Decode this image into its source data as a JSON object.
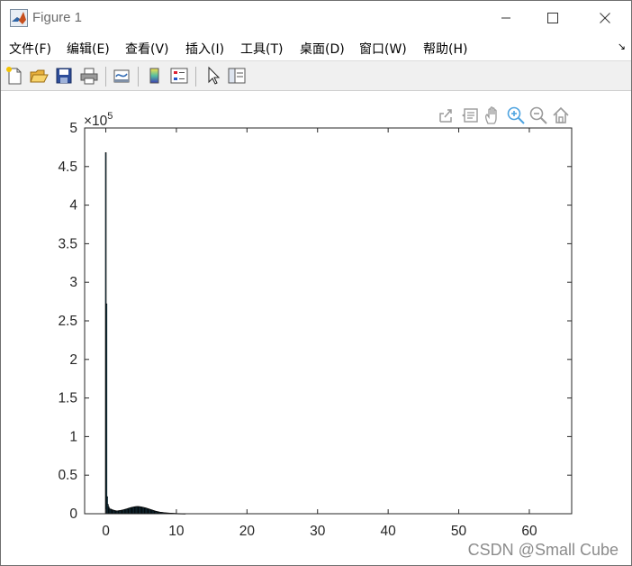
{
  "window": {
    "title": "Figure 1",
    "controls": [
      "minimize",
      "maximize",
      "close"
    ]
  },
  "menu": {
    "items": [
      "文件(F)",
      "编辑(E)",
      "查看(V)",
      "插入(I)",
      "工具(T)",
      "桌面(D)",
      "窗口(W)",
      "帮助(H)"
    ]
  },
  "toolbar": {
    "icons": [
      "new-figure-icon",
      "open-file-icon",
      "save-icon",
      "print-icon",
      "link-plot-icon",
      "colorbar-icon",
      "legend-icon",
      "pointer-icon",
      "property-inspector-icon"
    ]
  },
  "axes_toolbar": {
    "icons": [
      "export-icon",
      "data-tips-icon",
      "pan-icon",
      "zoom-in-icon",
      "zoom-out-icon",
      "home-icon"
    ]
  },
  "chart_data": {
    "type": "bar",
    "title": "",
    "xlabel": "",
    "ylabel": "",
    "xlim": [
      -3,
      66
    ],
    "ylim": [
      0,
      500000
    ],
    "y_exponent_label": "×10",
    "y_exponent": "5",
    "xticks": [
      0,
      10,
      20,
      30,
      40,
      50,
      60
    ],
    "yticks": [
      0,
      50000,
      100000,
      150000,
      200000,
      250000,
      300000,
      350000,
      400000,
      450000,
      500000
    ],
    "ytick_labels": [
      "0",
      "0.5",
      "1",
      "1.5",
      "2",
      "2.5",
      "3",
      "3.5",
      "4",
      "4.5",
      "5"
    ],
    "bar_width": 0.1,
    "x": [
      0,
      0.1,
      0.2,
      0.3,
      0.4,
      0.5,
      0.6,
      0.7,
      0.8,
      0.9,
      1.0,
      1.1,
      1.2,
      1.3,
      1.4,
      1.5,
      1.6,
      1.7,
      1.8,
      1.9,
      2.0,
      2.1,
      2.2,
      2.3,
      2.4,
      2.5,
      2.6,
      2.7,
      2.8,
      2.9,
      3.0,
      3.1,
      3.2,
      3.3,
      3.4,
      3.5,
      3.6,
      3.7,
      3.8,
      3.9,
      4.0,
      4.1,
      4.2,
      4.3,
      4.4,
      4.5,
      4.6,
      4.7,
      4.8,
      4.9,
      5.0,
      5.1,
      5.2,
      5.3,
      5.4,
      5.5,
      5.6,
      5.7,
      5.8,
      5.9,
      6.0,
      6.1,
      6.2,
      6.3,
      6.4,
      6.5,
      6.6,
      6.7,
      6.8,
      6.9,
      7.0,
      7.1,
      7.2,
      7.3,
      7.4,
      7.5,
      7.6,
      7.7,
      7.8,
      7.9,
      8.0,
      8.1,
      8.2,
      8.3,
      8.4,
      8.5,
      8.6,
      8.7,
      8.8,
      8.9,
      9.0,
      9.1,
      9.2,
      9.3,
      9.4,
      9.5,
      9.6,
      9.7,
      9.8,
      9.9,
      10.0,
      10.2,
      10.4,
      10.6,
      10.8,
      11.0,
      11.2
    ],
    "values": [
      468000,
      272000,
      22000,
      12000,
      9000,
      7000,
      6000,
      6000,
      5500,
      5000,
      4800,
      4500,
      4200,
      4000,
      3800,
      3600,
      3600,
      3700,
      3800,
      4000,
      4000,
      4200,
      4400,
      4600,
      4800,
      5000,
      5200,
      5500,
      5800,
      6000,
      6300,
      6600,
      6900,
      7200,
      7500,
      7800,
      8000,
      8200,
      8400,
      8600,
      8800,
      9000,
      9100,
      9200,
      9300,
      9300,
      9300,
      9200,
      9100,
      9000,
      8800,
      8600,
      8400,
      8200,
      8000,
      7800,
      7600,
      7300,
      7000,
      6700,
      6400,
      6100,
      5800,
      5500,
      5200,
      4900,
      4600,
      4300,
      4000,
      3700,
      3400,
      3100,
      2900,
      2700,
      2500,
      2300,
      2100,
      1900,
      1800,
      1700,
      1600,
      1500,
      1400,
      1300,
      1200,
      1100,
      1000,
      950,
      900,
      850,
      800,
      750,
      700,
      650,
      600,
      550,
      500,
      450,
      400,
      380,
      350,
      300,
      260,
      220,
      180,
      150,
      120
    ],
    "bar_color": "#4dbeee",
    "edge_color": "#000000",
    "grid": false
  },
  "watermark": "CSDN @Small Cube"
}
